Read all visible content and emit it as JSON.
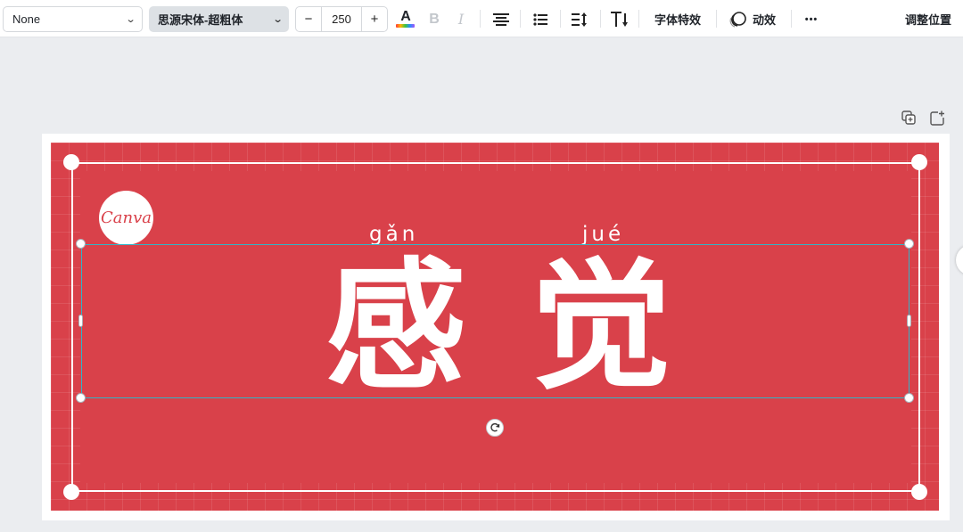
{
  "toolbar": {
    "effect_select": "None",
    "font_select": "思源宋体-超粗体",
    "font_size": "250",
    "decrease_label": "−",
    "increase_label": "+",
    "text_color_label": "A",
    "bold_label": "B",
    "italic_label": "I",
    "effects_label": "字体特效",
    "animate_label": "动效",
    "more_label": "•••",
    "position_label": "调整位置"
  },
  "canvas": {
    "logo_text": "Canva",
    "pinyin_1": "gǎn",
    "pinyin_2": "jué",
    "char_1": "感",
    "char_2": "觉",
    "background_color": "#d9414a",
    "selection_color": "#2fb5c8"
  }
}
